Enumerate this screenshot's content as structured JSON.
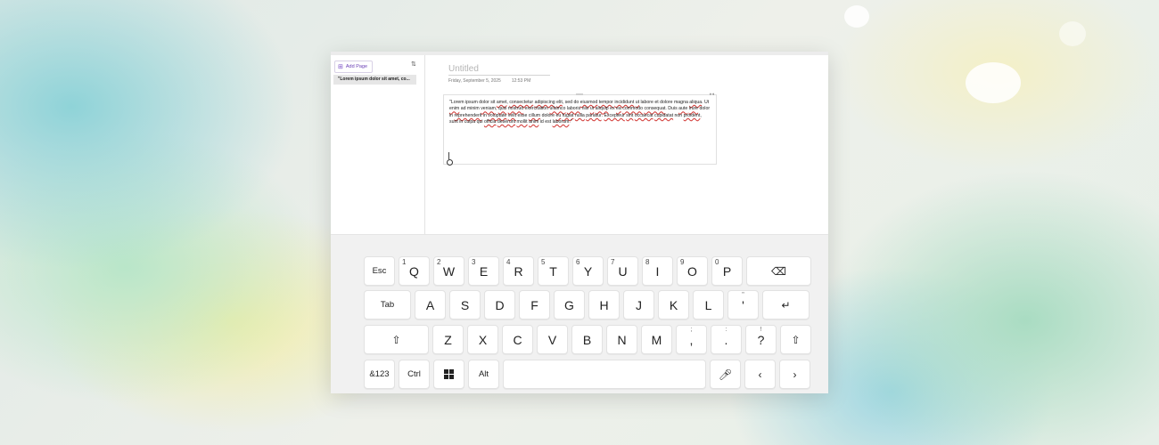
{
  "sidebar": {
    "add_page_label": "Add Page",
    "add_icon": "plus-square-icon",
    "sort_icon": "sort-icon",
    "pages": [
      "\"Lorem ipsum dolor sit amet, co..."
    ]
  },
  "page": {
    "title_placeholder": "Untitled",
    "date": "Friday, September 5, 2025",
    "time": "12:53 PM",
    "note_text": [
      "\"Lorem ipsum dolor sit ",
      {
        "w": "amet"
      },
      ", ",
      {
        "w": "consectetur"
      },
      " ",
      {
        "w": "adipiscing"
      },
      " ",
      {
        "w": "elit"
      },
      ", sed do ",
      {
        "w": "eiusmod"
      },
      " ",
      {
        "w": "tempor"
      },
      " ",
      {
        "w": "incididunt"
      },
      " ",
      {
        "w": "ut"
      },
      " labore et dolore magna ",
      {
        "w": "aliqua"
      },
      ". Ut ",
      {
        "w": "enim"
      },
      " ad minim ",
      {
        "w": "veniam"
      },
      ", ",
      {
        "w": "quis"
      },
      " ",
      {
        "w": "nostrud"
      },
      " exercitation ",
      {
        "w": "ullamco"
      },
      " ",
      {
        "w": "laboris"
      },
      " nisi ",
      {
        "w": "ut"
      },
      " ",
      {
        "w": "aliquip"
      },
      " ex ",
      {
        "w": "ea"
      },
      " ",
      {
        "w": "commodo"
      },
      " ",
      {
        "w": "consequat"
      },
      ". Duis ",
      {
        "w": "aute"
      },
      " ",
      {
        "w": "irure"
      },
      " dolor in ",
      {
        "w": "reprehenderit"
      },
      " in ",
      {
        "w": "voluptate"
      },
      " ",
      {
        "w": "velit"
      },
      " esse ",
      {
        "w": "cillum"
      },
      " dolore ",
      {
        "w": "eu"
      },
      " ",
      {
        "w": "fugiat"
      },
      " ",
      {
        "w": "nulla"
      },
      " ",
      {
        "w": "pariatur"
      },
      ". ",
      {
        "w": "Excepteur"
      },
      " ",
      {
        "w": "sint"
      },
      " ",
      {
        "w": "occaecat"
      },
      " ",
      {
        "w": "cupidatat"
      },
      " non ",
      {
        "w": "proident"
      },
      ", sunt in culpa qui ",
      {
        "w": "officia"
      },
      " ",
      {
        "w": "deserunt"
      },
      " ",
      {
        "w": "mollit"
      },
      " ",
      {
        "w": "anim"
      },
      " id est ",
      {
        "w": "laborum"
      },
      ".\""
    ]
  },
  "keyboard": {
    "rows": [
      [
        {
          "label": "Esc",
          "name": "esc"
        },
        {
          "label": "Q",
          "num": "1"
        },
        {
          "label": "W",
          "num": "2"
        },
        {
          "label": "E",
          "num": "3"
        },
        {
          "label": "R",
          "num": "4"
        },
        {
          "label": "T",
          "num": "5"
        },
        {
          "label": "Y",
          "num": "6"
        },
        {
          "label": "U",
          "num": "7"
        },
        {
          "label": "I",
          "num": "8"
        },
        {
          "label": "O",
          "num": "9"
        },
        {
          "label": "P",
          "num": "0"
        },
        {
          "label": "⌫",
          "name": "backspace",
          "icon": "backspace-icon"
        }
      ],
      [
        {
          "label": "Tab",
          "name": "tab"
        },
        {
          "label": "A"
        },
        {
          "label": "S"
        },
        {
          "label": "D"
        },
        {
          "label": "F"
        },
        {
          "label": "G"
        },
        {
          "label": "H"
        },
        {
          "label": "J"
        },
        {
          "label": "K"
        },
        {
          "label": "L"
        },
        {
          "label": "'",
          "sub": "\"",
          "name": "apostrophe"
        },
        {
          "label": "↵",
          "name": "enter",
          "icon": "enter-icon"
        }
      ],
      [
        {
          "label": "⇧",
          "name": "shift-left",
          "icon": "shift-icon"
        },
        {
          "label": "Z"
        },
        {
          "label": "X"
        },
        {
          "label": "C"
        },
        {
          "label": "V"
        },
        {
          "label": "B"
        },
        {
          "label": "N"
        },
        {
          "label": "M"
        },
        {
          "label": ",",
          "sub": ";",
          "name": "comma"
        },
        {
          "label": ".",
          "sub": ":",
          "name": "period"
        },
        {
          "label": "?",
          "sub": "!",
          "name": "question"
        },
        {
          "label": "⇧",
          "name": "shift-right",
          "icon": "shift-icon"
        }
      ],
      [
        {
          "label": "&123",
          "name": "symbols"
        },
        {
          "label": "Ctrl",
          "name": "ctrl"
        },
        {
          "label": "",
          "name": "windows",
          "icon": "windows-icon"
        },
        {
          "label": "Alt",
          "name": "alt"
        },
        {
          "label": "",
          "name": "space"
        },
        {
          "label": "🎤︎",
          "name": "microphone",
          "icon": "microphone-icon"
        },
        {
          "label": "‹",
          "name": "left-arrow",
          "icon": "chevron-left-icon"
        },
        {
          "label": "›",
          "name": "right-arrow",
          "icon": "chevron-right-icon"
        }
      ]
    ]
  }
}
